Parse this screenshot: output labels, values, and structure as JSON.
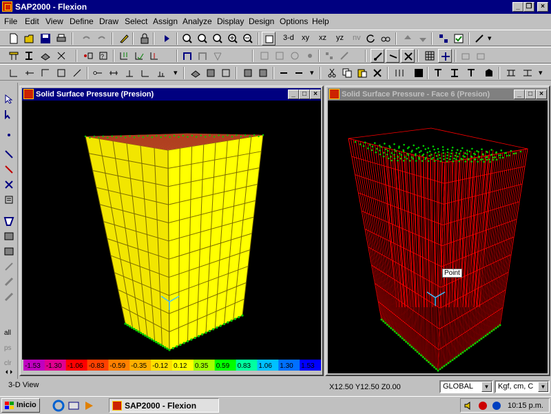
{
  "app": {
    "title": "SAP2000 - Flexion"
  },
  "menu": [
    "File",
    "Edit",
    "View",
    "Define",
    "Draw",
    "Select",
    "Assign",
    "Analyze",
    "Display",
    "Design",
    "Options",
    "Help"
  ],
  "toolbar": {
    "view_3d": "3-d",
    "view_xy": "xy",
    "view_xz": "xz",
    "view_yz": "yz",
    "view_nv": "nv"
  },
  "windows": {
    "left": {
      "title": "Solid Surface Pressure (Presion)"
    },
    "right": {
      "title": "Solid Surface Pressure - Face 6 (Presion)",
      "point_label": "Point"
    }
  },
  "legend": {
    "values": [
      "-1.53",
      "-1.30",
      "-1.06",
      "-0.83",
      "-0.59",
      "-0.35",
      "-0.12",
      "0.12",
      "0.35",
      "0.59",
      "0.83",
      "1.06",
      "1.30",
      "1.53"
    ],
    "colors": [
      "#c000c0",
      "#e00090",
      "#ff0000",
      "#ff4000",
      "#ff8000",
      "#ffb000",
      "#ffe000",
      "#ffff00",
      "#a0ff00",
      "#00ff00",
      "#00ffa0",
      "#00c0ff",
      "#0070ff",
      "#0000ff"
    ]
  },
  "status": {
    "view": "3-D View",
    "coords": "X12.50  Y12.50  Z0.00",
    "coord_system": "GLOBAL",
    "units": "Kgf, cm, C"
  },
  "taskbar": {
    "start": "Inicio",
    "task": "SAP2000 - Flexion",
    "clock": "10:15 p.m."
  },
  "colors": {
    "title_active": "#000080",
    "surface": "#ffff00",
    "mesh": "#ff0000",
    "supports": "#00cc00"
  }
}
